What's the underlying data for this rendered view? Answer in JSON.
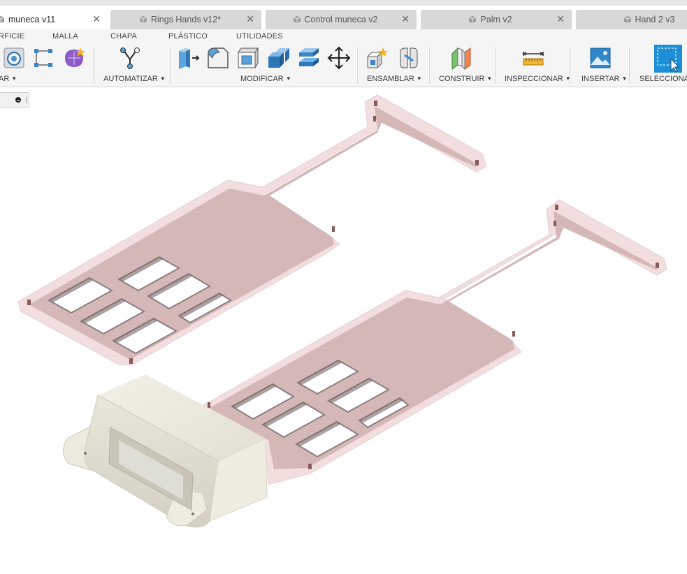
{
  "tabs": [
    {
      "label": "muneca v11",
      "active": true
    },
    {
      "label": "Rings Hands v12*",
      "active": false
    },
    {
      "label": "Control muneca v2",
      "active": false
    },
    {
      "label": "Palm v2",
      "active": false
    },
    {
      "label": "Hand 2 v3",
      "active": false
    }
  ],
  "toolbar": {
    "categories": [
      "RFICIE",
      "MALLA",
      "CHAPA",
      "PLÁSTICO",
      "UTILIDADES"
    ],
    "groups": {
      "crear": "AR",
      "automatizar": "AUTOMATIZAR",
      "modificar": "MODIFICAR",
      "ensamblar": "ENSAMBLAR",
      "construir": "CONSTRUIR",
      "inspeccionar": "INSPECCIONAR",
      "insertar": "INSERTAR",
      "seleccionar": "SELECCIONAR"
    },
    "icons": {
      "crear": [
        "revolve-icon",
        "sketch-points-icon",
        "form-star-icon"
      ],
      "automatizar": [
        "automate-icon"
      ],
      "modificar": [
        "press-pull-icon",
        "fillet-icon",
        "shell-icon",
        "combine-icon",
        "stack-icon",
        "move-icon"
      ],
      "ensamblar": [
        "new-component-icon",
        "joint-icon"
      ],
      "construir": [
        "plane-icon"
      ],
      "inspeccionar": [
        "measure-icon"
      ],
      "insertar": [
        "insert-image-icon"
      ],
      "seleccionar": [
        "select-icon"
      ]
    }
  },
  "colors": {
    "accent_select": "#1e8fd6",
    "plate_fill": "#d1b4b5",
    "plate_rim": "#f1dcdc",
    "mount_body": "#e9e7dc"
  }
}
